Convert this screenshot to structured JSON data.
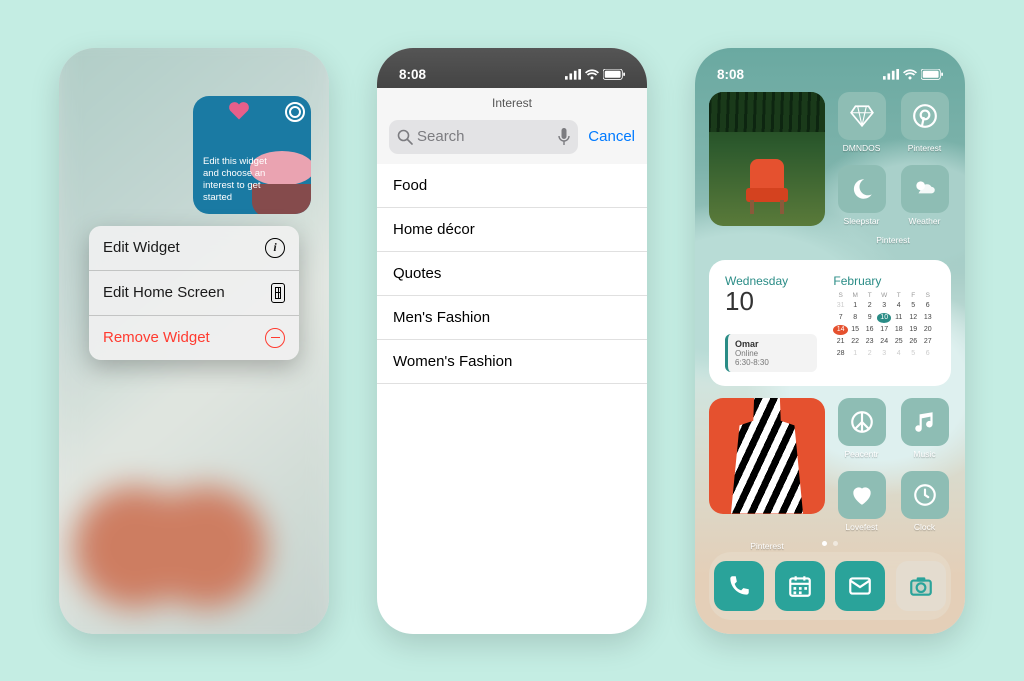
{
  "phone1": {
    "widget_text": "Edit this widget and choose an interest to get started",
    "menu": {
      "edit_widget": "Edit Widget",
      "edit_home": "Edit Home Screen",
      "remove": "Remove Widget"
    }
  },
  "phone2": {
    "time": "8:08",
    "header": "Interest",
    "search_placeholder": "Search",
    "cancel": "Cancel",
    "items": [
      "Food",
      "Home décor",
      "Quotes",
      "Men's Fashion",
      "Women's Fashion"
    ]
  },
  "phone3": {
    "time": "8:08",
    "apps_row1": [
      "DMNDOS",
      "Pinterest"
    ],
    "apps_row2": [
      "Sleepstar",
      "Weather"
    ],
    "pinterest_widget_label": "Pinterest",
    "calendar": {
      "dayname": "Wednesday",
      "daynum": "10",
      "month": "February",
      "event": {
        "title": "Omar",
        "subtitle": "Online",
        "time": "6:30-8:30"
      },
      "dow": [
        "S",
        "M",
        "T",
        "W",
        "T",
        "F",
        "S"
      ]
    },
    "apps_row3": [
      "Peacentr",
      "Music"
    ],
    "apps_row4": [
      "Lovefest",
      "Clock"
    ],
    "pinterest_widget2_label": "Pinterest",
    "dock": [
      "phone",
      "calendar",
      "mail",
      "camera"
    ]
  }
}
